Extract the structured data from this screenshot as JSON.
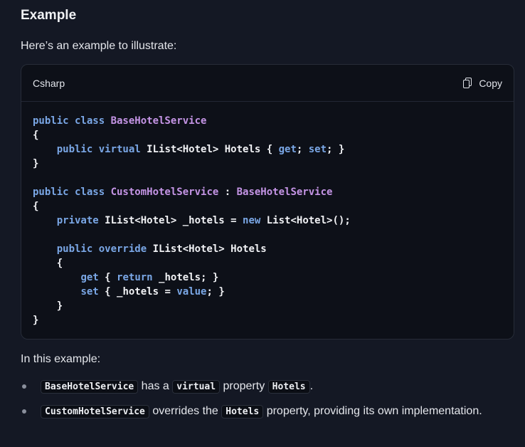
{
  "section": {
    "heading": "Example",
    "intro": "Here’s an example to illustrate:"
  },
  "code_block": {
    "language": "Csharp",
    "copy_label": "Copy",
    "lines": [
      [
        [
          "kw",
          "public class "
        ],
        [
          "ty",
          "BaseHotelService"
        ]
      ],
      [
        [
          "bp",
          "{"
        ]
      ],
      [
        [
          "bp",
          "    "
        ],
        [
          "kw",
          "public virtual "
        ],
        [
          "bp",
          "IList<Hotel> Hotels { "
        ],
        [
          "kw",
          "get"
        ],
        [
          "bp",
          "; "
        ],
        [
          "kw",
          "set"
        ],
        [
          "bp",
          "; }"
        ]
      ],
      [
        [
          "bp",
          "}"
        ]
      ],
      [],
      [
        [
          "kw",
          "public class "
        ],
        [
          "ty",
          "CustomHotelService"
        ],
        [
          "bp",
          " : "
        ],
        [
          "ty",
          "BaseHotelService"
        ]
      ],
      [
        [
          "bp",
          "{"
        ]
      ],
      [
        [
          "bp",
          "    "
        ],
        [
          "kw",
          "private "
        ],
        [
          "bp",
          "IList<Hotel> _hotels = "
        ],
        [
          "kw",
          "new "
        ],
        [
          "bp",
          "List<Hotel>();"
        ]
      ],
      [],
      [
        [
          "bp",
          "    "
        ],
        [
          "kw",
          "public override "
        ],
        [
          "bp",
          "IList<Hotel> Hotels"
        ]
      ],
      [
        [
          "bp",
          "    {"
        ]
      ],
      [
        [
          "bp",
          "        "
        ],
        [
          "kw",
          "get"
        ],
        [
          "bp",
          " { "
        ],
        [
          "kw",
          "return"
        ],
        [
          "bp",
          " _hotels; }"
        ]
      ],
      [
        [
          "bp",
          "        "
        ],
        [
          "kw",
          "set"
        ],
        [
          "bp",
          " { _hotels = "
        ],
        [
          "kw",
          "value"
        ],
        [
          "bp",
          "; }"
        ]
      ],
      [
        [
          "bp",
          "    }"
        ]
      ],
      [
        [
          "bp",
          "}"
        ]
      ]
    ]
  },
  "explanation": {
    "lead": "In this example:",
    "bullets": [
      {
        "parts": [
          {
            "code": "BaseHotelService"
          },
          {
            "text": " has a "
          },
          {
            "code": "virtual"
          },
          {
            "text": " property "
          },
          {
            "code": "Hotels"
          },
          {
            "text": "."
          }
        ]
      },
      {
        "parts": [
          {
            "code": "CustomHotelService"
          },
          {
            "text": " overrides the "
          },
          {
            "code": "Hotels"
          },
          {
            "text": " property, providing its own implementation."
          }
        ]
      }
    ]
  },
  "colors": {
    "background": "#141824",
    "code_background": "#0d1018",
    "keyword": "#7aa7e6",
    "type_name": "#c595e6",
    "text": "#e4e6eb"
  }
}
